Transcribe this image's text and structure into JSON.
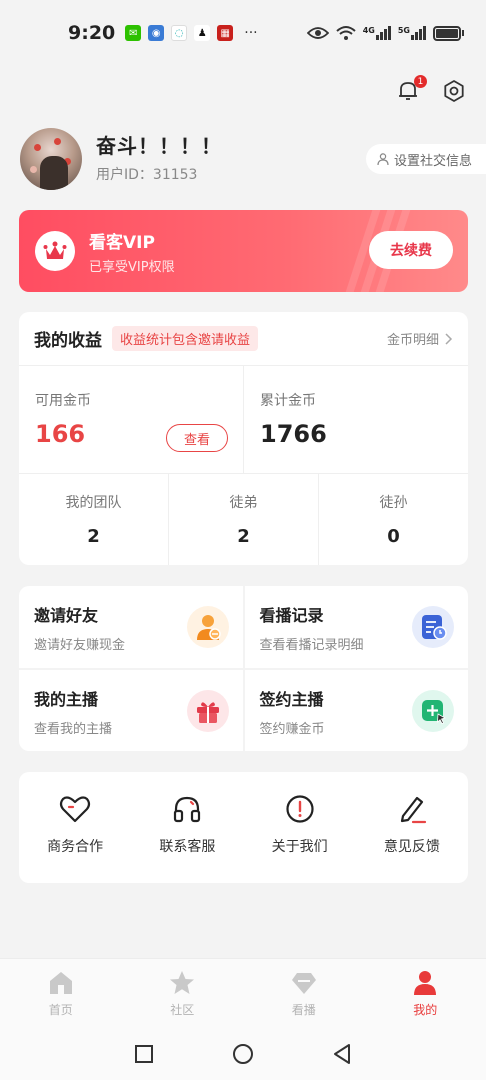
{
  "status_bar": {
    "time": "9:20",
    "network_4g": "4G",
    "network_5g": "5G"
  },
  "profile": {
    "username": "奋斗！！！！",
    "user_id_label": "用户ID：",
    "user_id": "31153",
    "social_button": "设置社交信息",
    "notification_count": "1"
  },
  "vip": {
    "title": "看客VIP",
    "subtitle": "已享受VIP权限",
    "button": "去续费"
  },
  "earnings": {
    "title": "我的收益",
    "tag": "收益统计包含邀请收益",
    "detail_link": "金币明细",
    "available_label": "可用金币",
    "available_value": "166",
    "view_button": "查看",
    "total_label": "累计金币",
    "total_value": "1766",
    "team": [
      {
        "label": "我的团队",
        "value": "2"
      },
      {
        "label": "徒弟",
        "value": "2"
      },
      {
        "label": "徒孙",
        "value": "0"
      }
    ]
  },
  "features": [
    {
      "title": "邀请好友",
      "subtitle": "邀请好友赚现金",
      "icon": "invite-user-icon"
    },
    {
      "title": "看播记录",
      "subtitle": "查看看播记录明细",
      "icon": "history-icon"
    },
    {
      "title": "我的主播",
      "subtitle": "查看我的主播",
      "icon": "gift-icon"
    },
    {
      "title": "签约主播",
      "subtitle": "签约赚金币",
      "icon": "sign-icon"
    }
  ],
  "quick_actions": [
    {
      "label": "商务合作",
      "icon": "heart-icon"
    },
    {
      "label": "联系客服",
      "icon": "headset-icon"
    },
    {
      "label": "关于我们",
      "icon": "info-icon"
    },
    {
      "label": "意见反馈",
      "icon": "pencil-icon"
    }
  ],
  "tabs": [
    {
      "label": "首页",
      "icon": "home-icon",
      "active": false
    },
    {
      "label": "社区",
      "icon": "star-icon",
      "active": false
    },
    {
      "label": "看播",
      "icon": "diamond-icon",
      "active": false
    },
    {
      "label": "我的",
      "icon": "person-icon",
      "active": true
    }
  ],
  "colors": {
    "accent": "#e84545",
    "vip_gradient_start": "#ff4d61",
    "vip_gradient_end": "#ff8a8a",
    "background": "#f3f3f3"
  }
}
